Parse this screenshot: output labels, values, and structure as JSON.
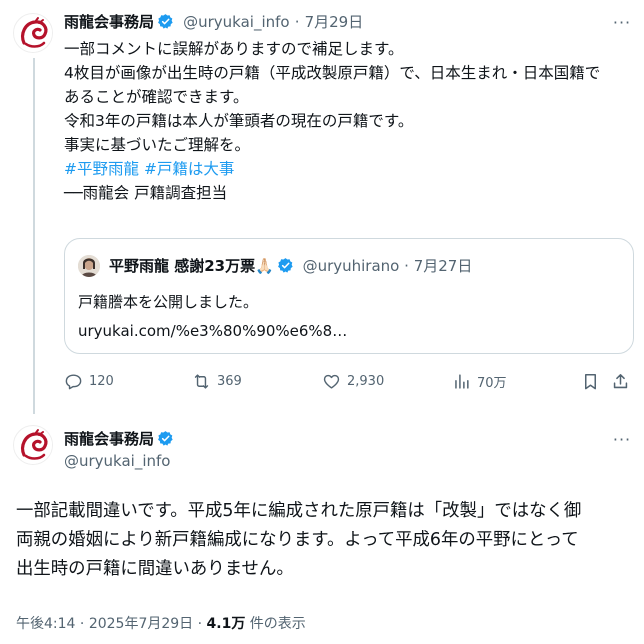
{
  "tweet1": {
    "display_name": "雨龍会事務局",
    "handle": "@uryukai_info",
    "separator": "·",
    "date": "7月29日",
    "lines": [
      "一部コメントに誤解がありますので補足します。",
      "4枚目が画像が出生時の戸籍（平成改製原戸籍）で、日本生まれ・日本国籍で",
      "あることが確認できます。",
      "令和3年の戸籍は本人が筆頭者の現在の戸籍です。",
      "事実に基づいたご理解を。"
    ],
    "hashtags": [
      "#平野雨龍",
      "#戸籍は大事"
    ],
    "signature": "──雨龍会 戸籍調査担当",
    "quote": {
      "display_name": "平野雨龍 感謝23万票🙏🏻",
      "handle": "@uryuhirano",
      "separator": "·",
      "date": "7月27日",
      "text": "戸籍謄本を公開しました。",
      "link": "uryukai.com/%e3%80%90%e6%8…"
    },
    "actions": {
      "replies": "120",
      "reposts": "369",
      "likes": "2,930",
      "views": "70万"
    }
  },
  "tweet2": {
    "display_name": "雨龍会事務局",
    "handle": "@uryukai_info",
    "lines": [
      "一部記載間違いです。平成5年に編成された原戸籍は「改製」ではなく御",
      "両親の婚姻により新戸籍編成になります。よって平成6年の平野にとって",
      "出生時の戸籍に間違いありません。"
    ],
    "meta": {
      "time": "午後4:14",
      "separator": "·",
      "date": "2025年7月29日",
      "views_count": "4.1万",
      "views_label": "件の表示"
    }
  },
  "colors": {
    "verified": "#1d9bf0",
    "hashtag": "#1d9bf0",
    "muted": "#536471",
    "logo_red": "#b5122b"
  },
  "icons": [
    "verified-badge-icon",
    "more-icon",
    "reply-icon",
    "repost-icon",
    "like-icon",
    "views-icon",
    "bookmark-icon",
    "share-icon"
  ]
}
